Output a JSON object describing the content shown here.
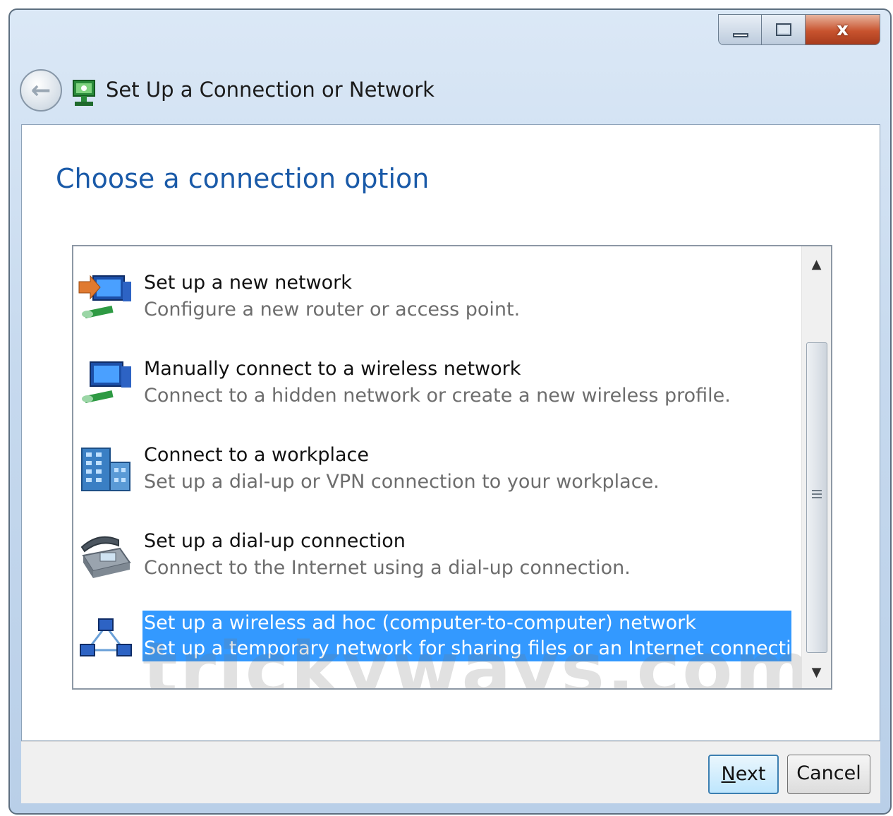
{
  "window": {
    "title": "Set Up a Connection or Network",
    "caption_buttons": {
      "minimize_icon": "minimize-icon",
      "maximize_icon": "maximize-icon",
      "close_glyph": "x"
    }
  },
  "main": {
    "heading": "Choose a connection option",
    "options": [
      {
        "icon": "new-network-icon",
        "title": "Set up a new network",
        "description": "Configure a new router or access point.",
        "selected": false
      },
      {
        "icon": "wireless-network-icon",
        "title": "Manually connect to a wireless network",
        "description": "Connect to a hidden network or create a new wireless profile.",
        "selected": false
      },
      {
        "icon": "workplace-icon",
        "title": "Connect to a workplace",
        "description": "Set up a dial-up or VPN connection to your workplace.",
        "selected": false
      },
      {
        "icon": "dialup-phone-icon",
        "title": "Set up a dial-up connection",
        "description": "Connect to the Internet using a dial-up connection.",
        "selected": false
      },
      {
        "icon": "adhoc-network-icon",
        "title": "Set up a wireless ad hoc (computer-to-computer) network",
        "description": "Set up a temporary network for sharing files or an Internet connection.",
        "selected": true
      }
    ],
    "watermark": "trickyways.com"
  },
  "footer": {
    "next": {
      "accel": "N",
      "rest": "ext"
    },
    "cancel_label": "Cancel"
  },
  "colors": {
    "heading": "#1a5aa8",
    "selection": "#3399ff",
    "close_button": "#c8532e"
  }
}
